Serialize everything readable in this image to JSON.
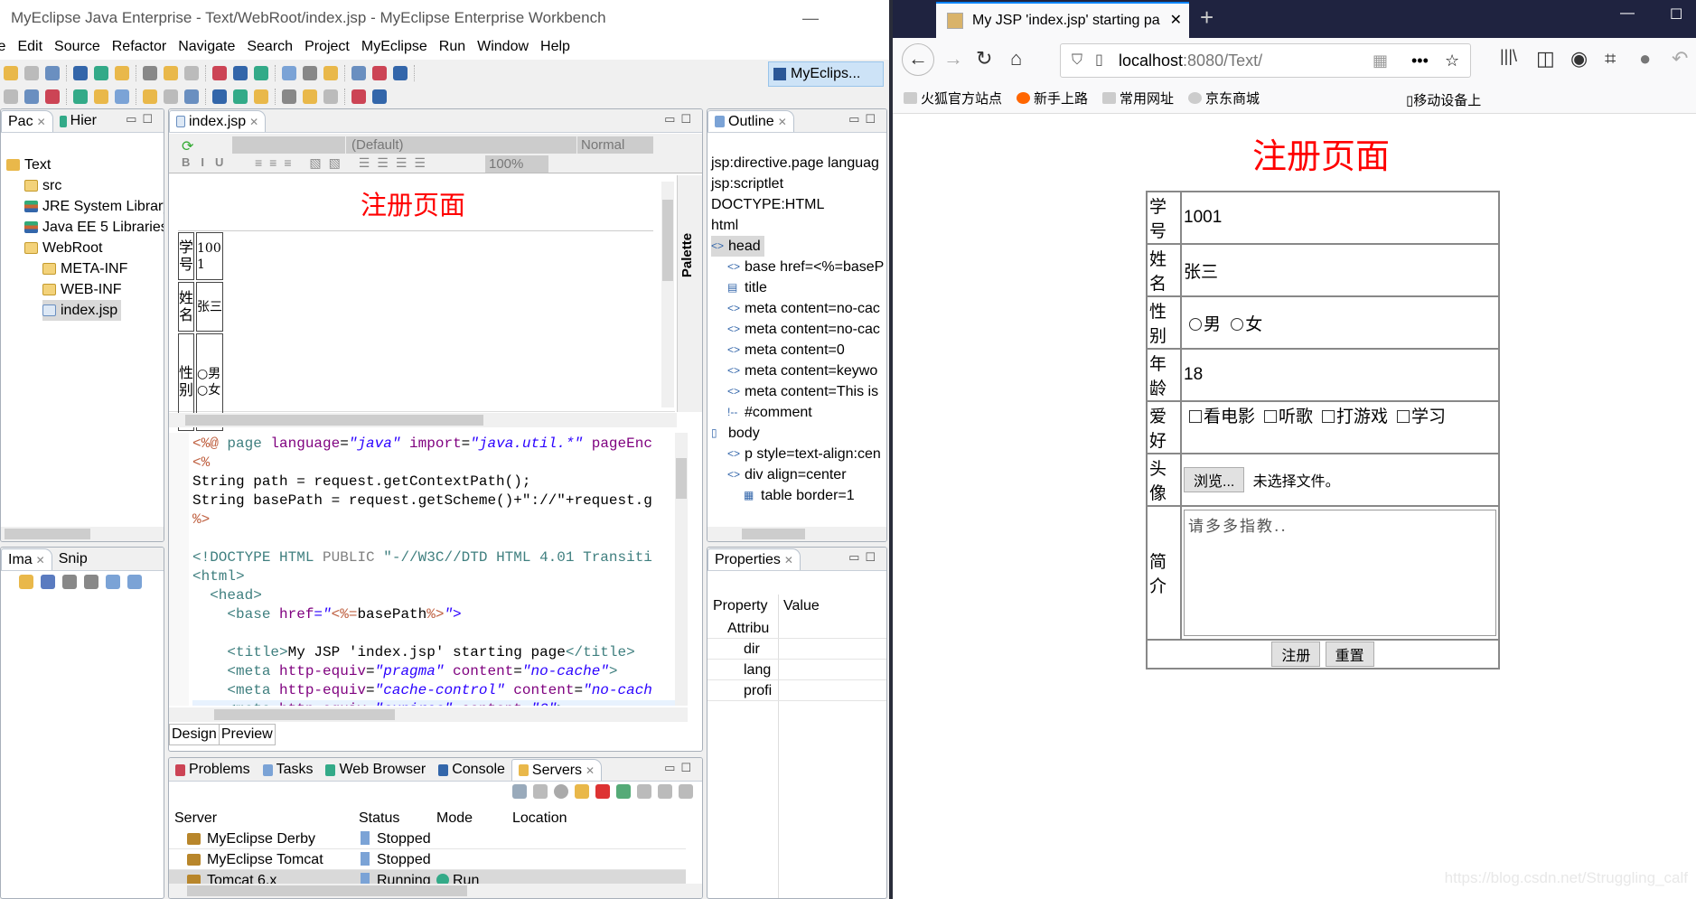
{
  "eclipse": {
    "title": "MyEclipse Java Enterprise - Text/WebRoot/index.jsp - MyEclipse Enterprise Workbench",
    "menu": [
      "le",
      "Edit",
      "Source",
      "Refactor",
      "Navigate",
      "Search",
      "Project",
      "MyEclipse",
      "Run",
      "Window",
      "Help"
    ],
    "perspective": "MyEclips...",
    "left_tabs": [
      "Pac",
      "Hier"
    ],
    "tree": [
      {
        "label": "Text",
        "depth": 0,
        "icon": "project-icon"
      },
      {
        "label": "src",
        "depth": 1,
        "icon": "package-folder-icon"
      },
      {
        "label": "JRE System Library",
        "depth": 1,
        "icon": "library-icon"
      },
      {
        "label": "Java EE 5 Libraries",
        "depth": 1,
        "icon": "library-icon"
      },
      {
        "label": "WebRoot",
        "depth": 1,
        "icon": "folder-icon"
      },
      {
        "label": "META-INF",
        "depth": 2,
        "icon": "folder-icon"
      },
      {
        "label": "WEB-INF",
        "depth": 2,
        "icon": "folder-icon"
      },
      {
        "label": "index.jsp",
        "depth": 2,
        "icon": "jsp-file-icon",
        "selected": true
      }
    ],
    "lower_left_tabs": [
      "Ima",
      "Snip"
    ],
    "editor": {
      "tab": "index.jsp",
      "style_select": "(Default)",
      "format_select": "Normal",
      "zoom": "100%",
      "palette": "Palette",
      "design": {
        "heading": "注册页面",
        "rows": [
          [
            "学号",
            "1001"
          ],
          [
            "姓名",
            "张三"
          ],
          [
            "性别",
            "○男 ○女"
          ]
        ]
      },
      "code": [
        [
          [
            "<%@ ",
            "c-jsp"
          ],
          [
            "page ",
            "c-tag"
          ],
          [
            "language",
            "c-attr"
          ],
          [
            "=",
            "c-txt"
          ],
          [
            "\"java\"",
            "c-str"
          ],
          [
            " import",
            "c-attr"
          ],
          [
            "=",
            "c-txt"
          ],
          [
            "\"java.util.*\"",
            "c-str"
          ],
          [
            " pageEnc",
            "c-attr"
          ]
        ],
        [
          [
            "<%",
            "c-jsp"
          ]
        ],
        [
          [
            "String path = request.getContextPath();",
            "c-txt"
          ]
        ],
        [
          [
            "String basePath = request.getScheme()+\"://\"+request.g",
            "c-txt"
          ]
        ],
        [
          [
            "%>",
            "c-jsp"
          ]
        ],
        [
          [
            "",
            "c-txt"
          ]
        ],
        [
          [
            "<!DOCTYPE HTML ",
            "c-tag"
          ],
          [
            "PUBLIC ",
            "c-doc"
          ],
          [
            "\"-//W3C//DTD HTML 4.01 Transiti",
            "c-tag"
          ]
        ],
        [
          [
            "<html>",
            "c-tag"
          ]
        ],
        [
          [
            "  <head>",
            "c-tag"
          ]
        ],
        [
          [
            "    <base ",
            "c-tag"
          ],
          [
            "href",
            "c-attr"
          ],
          [
            "=\"",
            "c-str"
          ],
          [
            "<%=",
            "c-jsp"
          ],
          [
            "basePath",
            "c-txt"
          ],
          [
            "%>",
            "c-jsp"
          ],
          [
            "\">",
            "c-str"
          ]
        ],
        [
          [
            "",
            "c-txt"
          ]
        ],
        [
          [
            "    <title>",
            "c-tag"
          ],
          [
            "My JSP 'index.jsp' starting page",
            "c-txt"
          ],
          [
            "</title>",
            "c-tag"
          ]
        ],
        [
          [
            "    <meta ",
            "c-tag"
          ],
          [
            "http-equiv",
            "c-attr"
          ],
          [
            "=",
            "c-txt"
          ],
          [
            "\"pragma\"",
            "c-str"
          ],
          [
            " content",
            "c-attr"
          ],
          [
            "=",
            "c-txt"
          ],
          [
            "\"no-cache\"",
            "c-str"
          ],
          [
            ">",
            "c-tag"
          ]
        ],
        [
          [
            "    <meta ",
            "c-tag"
          ],
          [
            "http-equiv",
            "c-attr"
          ],
          [
            "=",
            "c-txt"
          ],
          [
            "\"cache-control\"",
            "c-str"
          ],
          [
            " content",
            "c-attr"
          ],
          [
            "=",
            "c-txt"
          ],
          [
            "\"no-cach",
            "c-str"
          ]
        ],
        [
          [
            "    <meta ",
            "c-tag"
          ],
          [
            "http-equiv",
            "c-attr"
          ],
          [
            "=",
            "c-txt"
          ],
          [
            "\"expires\"",
            "c-str"
          ],
          [
            " content",
            "c-attr"
          ],
          [
            "=",
            "c-txt"
          ],
          [
            "\"0\"",
            "c-str"
          ],
          [
            ">",
            "c-tag"
          ]
        ]
      ],
      "bottom_tabs": [
        "Design",
        "Preview"
      ]
    },
    "outline": {
      "tab": "Outline",
      "items": [
        {
          "label": "jsp:directive.page languag",
          "depth": 0
        },
        {
          "label": "jsp:scriptlet",
          "depth": 0
        },
        {
          "label": "DOCTYPE:HTML",
          "depth": 0
        },
        {
          "label": "html",
          "depth": 0
        },
        {
          "label": "head",
          "depth": 0,
          "icon": "<>",
          "selected": true
        },
        {
          "label": "base href=<%=baseP",
          "depth": 1,
          "icon": "<>"
        },
        {
          "label": "title",
          "depth": 1,
          "icon": "▤"
        },
        {
          "label": "meta content=no-cac",
          "depth": 1,
          "icon": "<>"
        },
        {
          "label": "meta content=no-cac",
          "depth": 1,
          "icon": "<>"
        },
        {
          "label": "meta content=0",
          "depth": 1,
          "icon": "<>"
        },
        {
          "label": "meta content=keywo",
          "depth": 1,
          "icon": "<>"
        },
        {
          "label": "meta content=This is",
          "depth": 1,
          "icon": "<>"
        },
        {
          "label": "#comment",
          "depth": 1,
          "icon": "!--"
        },
        {
          "label": "body",
          "depth": 0,
          "icon": "▯"
        },
        {
          "label": "p style=text-align:cen",
          "depth": 1,
          "icon": "<>"
        },
        {
          "label": "div align=center",
          "depth": 1,
          "icon": "<>"
        },
        {
          "label": "table border=1",
          "depth": 2,
          "icon": "▦"
        }
      ]
    },
    "properties": {
      "tab": "Properties",
      "headers": [
        "Property",
        "Value"
      ],
      "rows": [
        "Attribu",
        "dir",
        "lang",
        "profi"
      ]
    },
    "views": {
      "tabs": [
        "Problems",
        "Tasks",
        "Web Browser",
        "Console",
        "Servers"
      ],
      "headers": [
        "Server",
        "Status",
        "Mode",
        "Location"
      ],
      "rows": [
        {
          "server": "MyEclipse Derby",
          "status": "Stopped",
          "mode": ""
        },
        {
          "server": "MyEclipse Tomcat",
          "status": "Stopped",
          "mode": ""
        },
        {
          "server": "Tomcat  6.x",
          "status": "Running",
          "mode": "Run",
          "selected": true
        }
      ]
    }
  },
  "browser": {
    "tab_title": "My JSP 'index.jsp' starting pa",
    "url_host": "localhost",
    "url_rest": ":8080/Text/",
    "bookmarks": [
      "火狐官方站点",
      "新手上路",
      "常用网址",
      "京东商城"
    ],
    "mobile": "移动设备上",
    "page": {
      "heading": "注册页面",
      "heading_color": "#ff0000",
      "labels": {
        "id": "学号",
        "name": "姓名",
        "gender": "性别",
        "age": "年龄",
        "hobby": "爱好",
        "avatar": "头像",
        "intro": "简介"
      },
      "id": "1001",
      "name": "张三",
      "genders": [
        "男",
        "女"
      ],
      "age": "18",
      "hobbies": [
        "看电影",
        "听歌",
        "打游戏",
        "学习"
      ],
      "browse": "浏览...",
      "no_file": "未选择文件。",
      "intro": "请多多指教..",
      "submit": "注册",
      "reset": "重置"
    },
    "watermark": "https://blog.csdn.net/Struggling_calf"
  }
}
